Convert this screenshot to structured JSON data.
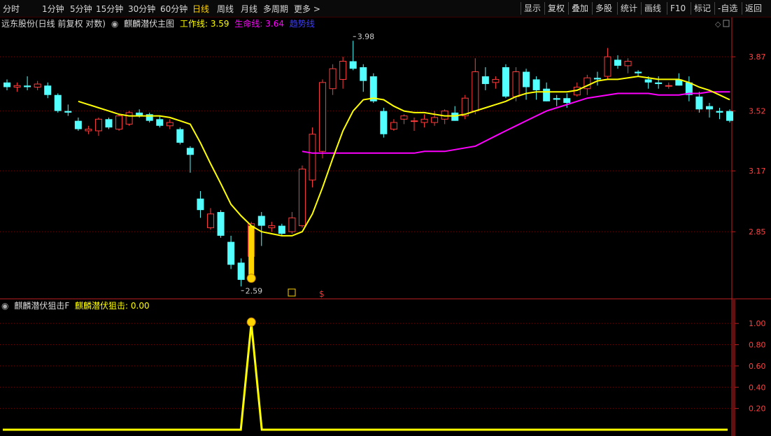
{
  "toolbar": {
    "periods": [
      "分时",
      "1分钟",
      "5分钟",
      "15分钟",
      "30分钟",
      "60分钟",
      "日线",
      "周线",
      "月线",
      "多周期",
      "更多 >"
    ],
    "active_period": "日线",
    "right_buttons": [
      "显示",
      "复权",
      "叠加",
      "多股",
      "统计",
      "画线",
      "F10",
      "标记",
      "-自选",
      "返回"
    ]
  },
  "main_header": {
    "stock": "远东股份(日线 前复权 对数)",
    "indicator": "麒麟潜伏主图",
    "work_label": "工作线: 3.59",
    "life_label": "生命线: 3.64",
    "trend_label": "趋势线"
  },
  "sub_header": {
    "indicator": "麒麟潜伏狙击F",
    "value_label": "麒麟潜伏狙击: 0.00"
  },
  "colors": {
    "up": "#ff3c3c",
    "down": "#54ffff",
    "work": "#ffff00",
    "life": "#ff00ff",
    "trend": "#3c3cff",
    "grid": "#7a0000",
    "axis": "#c02020"
  },
  "chart_data": [
    {
      "type": "candlestick",
      "y_ticks": [
        3.87,
        3.52,
        3.17,
        2.85
      ],
      "ylim": [
        2.55,
        4.05
      ],
      "log_scale": true,
      "annotations": {
        "high": "3.98",
        "low": "2.59"
      },
      "ohlc": [
        [
          3.7,
          3.72,
          3.65,
          3.67
        ],
        [
          3.67,
          3.7,
          3.64,
          3.68
        ],
        [
          3.68,
          3.74,
          3.65,
          3.67
        ],
        [
          3.67,
          3.71,
          3.65,
          3.69
        ],
        [
          3.68,
          3.7,
          3.6,
          3.62
        ],
        [
          3.62,
          3.63,
          3.51,
          3.52
        ],
        [
          3.52,
          3.56,
          3.49,
          3.51
        ],
        [
          3.46,
          3.48,
          3.4,
          3.41
        ],
        [
          3.4,
          3.43,
          3.38,
          3.41
        ],
        [
          3.4,
          3.48,
          3.37,
          3.47
        ],
        [
          3.47,
          3.48,
          3.41,
          3.42
        ],
        [
          3.41,
          3.5,
          3.4,
          3.49
        ],
        [
          3.44,
          3.52,
          3.43,
          3.51
        ],
        [
          3.51,
          3.53,
          3.48,
          3.49
        ],
        [
          3.5,
          3.51,
          3.45,
          3.46
        ],
        [
          3.47,
          3.49,
          3.42,
          3.43
        ],
        [
          3.43,
          3.47,
          3.41,
          3.45
        ],
        [
          3.41,
          3.42,
          3.32,
          3.33
        ],
        [
          3.3,
          3.31,
          3.16,
          3.26
        ],
        [
          3.02,
          3.06,
          2.92,
          2.96
        ],
        [
          2.87,
          2.97,
          2.86,
          2.94
        ],
        [
          2.95,
          2.96,
          2.82,
          2.83
        ],
        [
          2.8,
          2.83,
          2.67,
          2.69
        ],
        [
          2.7,
          2.72,
          2.59,
          2.62
        ],
        [
          2.73,
          2.9,
          2.72,
          2.89
        ],
        [
          2.93,
          2.95,
          2.78,
          2.88
        ],
        [
          2.87,
          2.9,
          2.85,
          2.88
        ],
        [
          2.88,
          2.89,
          2.83,
          2.84
        ],
        [
          2.85,
          2.95,
          2.84,
          2.92
        ],
        [
          2.88,
          3.2,
          2.87,
          3.18
        ],
        [
          3.12,
          3.42,
          3.08,
          3.38
        ],
        [
          3.28,
          3.72,
          3.24,
          3.7
        ],
        [
          3.66,
          3.82,
          3.62,
          3.79
        ],
        [
          3.72,
          3.87,
          3.66,
          3.84
        ],
        [
          3.84,
          3.98,
          3.78,
          3.79
        ],
        [
          3.8,
          3.82,
          3.64,
          3.71
        ],
        [
          3.74,
          3.76,
          3.57,
          3.58
        ],
        [
          3.52,
          3.54,
          3.36,
          3.38
        ],
        [
          3.41,
          3.47,
          3.4,
          3.45
        ],
        [
          3.47,
          3.5,
          3.44,
          3.49
        ],
        [
          3.46,
          3.48,
          3.4,
          3.46
        ],
        [
          3.45,
          3.5,
          3.42,
          3.47
        ],
        [
          3.45,
          3.52,
          3.43,
          3.48
        ],
        [
          3.47,
          3.53,
          3.44,
          3.52
        ],
        [
          3.51,
          3.55,
          3.46,
          3.46
        ],
        [
          3.49,
          3.62,
          3.47,
          3.6
        ],
        [
          3.52,
          3.86,
          3.5,
          3.77
        ],
        [
          3.74,
          3.8,
          3.65,
          3.69
        ],
        [
          3.7,
          3.74,
          3.66,
          3.72
        ],
        [
          3.8,
          3.82,
          3.6,
          3.61
        ],
        [
          3.61,
          3.8,
          3.58,
          3.77
        ],
        [
          3.77,
          3.79,
          3.59,
          3.67
        ],
        [
          3.72,
          3.74,
          3.59,
          3.65
        ],
        [
          3.66,
          3.7,
          3.58,
          3.58
        ],
        [
          3.6,
          3.62,
          3.55,
          3.59
        ],
        [
          3.6,
          3.63,
          3.54,
          3.57
        ],
        [
          3.62,
          3.7,
          3.61,
          3.67
        ],
        [
          3.66,
          3.75,
          3.62,
          3.73
        ],
        [
          3.73,
          3.77,
          3.68,
          3.72
        ],
        [
          3.74,
          3.93,
          3.72,
          3.87
        ],
        [
          3.85,
          3.88,
          3.79,
          3.81
        ],
        [
          3.81,
          3.86,
          3.76,
          3.84
        ],
        [
          3.77,
          3.78,
          3.74,
          3.76
        ],
        [
          3.72,
          3.74,
          3.66,
          3.7
        ],
        [
          3.7,
          3.74,
          3.66,
          3.69
        ],
        [
          3.68,
          3.7,
          3.66,
          3.68
        ],
        [
          3.72,
          3.76,
          3.68,
          3.68
        ],
        [
          3.7,
          3.74,
          3.58,
          3.62
        ],
        [
          3.61,
          3.64,
          3.51,
          3.53
        ],
        [
          3.55,
          3.57,
          3.48,
          3.53
        ],
        [
          3.52,
          3.54,
          3.47,
          3.51
        ],
        [
          3.52,
          3.53,
          3.45,
          3.46
        ]
      ],
      "work_line": [
        null,
        null,
        null,
        null,
        null,
        null,
        null,
        3.58,
        3.56,
        3.54,
        3.52,
        3.5,
        3.49,
        3.49,
        3.49,
        3.49,
        3.48,
        3.46,
        3.44,
        3.33,
        3.21,
        3.1,
        2.99,
        2.93,
        2.88,
        2.85,
        2.84,
        2.83,
        2.83,
        2.85,
        2.94,
        3.08,
        3.24,
        3.4,
        3.52,
        3.59,
        3.6,
        3.59,
        3.55,
        3.52,
        3.51,
        3.51,
        3.5,
        3.49,
        3.49,
        3.5,
        3.52,
        3.54,
        3.56,
        3.58,
        3.61,
        3.63,
        3.64,
        3.64,
        3.64,
        3.64,
        3.65,
        3.68,
        3.71,
        3.72,
        3.72,
        3.73,
        3.74,
        3.73,
        3.72,
        3.72,
        3.72,
        3.7,
        3.67,
        3.65,
        3.62,
        3.59
      ],
      "life_line": [
        null,
        null,
        null,
        null,
        null,
        null,
        null,
        null,
        null,
        null,
        null,
        null,
        null,
        null,
        null,
        null,
        null,
        null,
        null,
        null,
        null,
        null,
        null,
        null,
        null,
        null,
        null,
        null,
        null,
        3.28,
        3.27,
        3.27,
        3.27,
        3.27,
        3.27,
        3.27,
        3.27,
        3.27,
        3.27,
        3.27,
        3.27,
        3.28,
        3.28,
        3.28,
        3.29,
        3.3,
        3.31,
        3.34,
        3.37,
        3.4,
        3.43,
        3.46,
        3.49,
        3.52,
        3.54,
        3.56,
        3.58,
        3.6,
        3.61,
        3.62,
        3.63,
        3.63,
        3.63,
        3.63,
        3.62,
        3.62,
        3.62,
        3.63,
        3.63,
        3.64,
        3.64,
        3.64
      ]
    },
    {
      "type": "line",
      "y_ticks": [
        "1.00",
        "0.80",
        "0.60",
        "0.40",
        "0.20"
      ],
      "ylim": [
        0,
        1.1
      ],
      "signal_index": 23,
      "values_note": "",
      "signal_value": 1.0
    }
  ]
}
